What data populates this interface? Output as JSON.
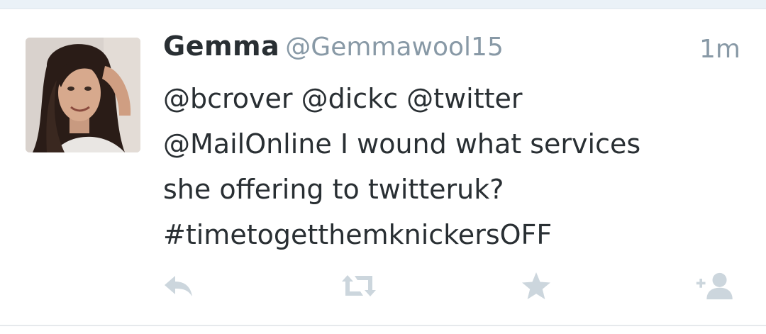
{
  "tweet": {
    "display_name": "Gemma",
    "handle": "@Gemmawool15",
    "timestamp": "1m",
    "text": "@bcrover @dickc @twitter\n@MailOnline I wound what services\nshe offering to twitteruk?\n#timetogetthemknickersOFF"
  },
  "actions": [
    {
      "name": "reply",
      "icon": "reply-icon"
    },
    {
      "name": "retweet",
      "icon": "retweet-icon"
    },
    {
      "name": "favorite",
      "icon": "star-icon"
    },
    {
      "name": "follow",
      "icon": "follow-user-icon"
    }
  ],
  "colors": {
    "name": "#292f33",
    "muted": "#8899a6",
    "icon": "#ccd6dd",
    "top_bar": "#eaf1f7"
  }
}
